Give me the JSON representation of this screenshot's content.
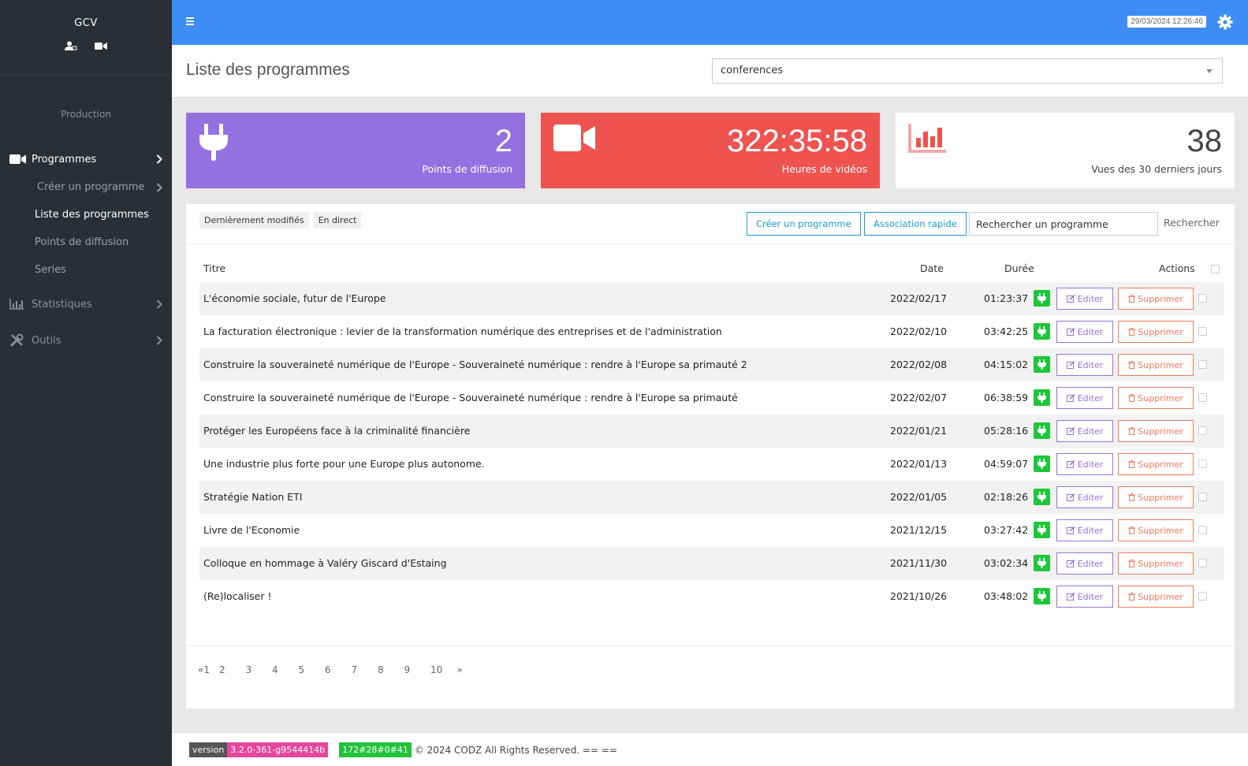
{
  "brand": {
    "name": "GCV"
  },
  "sidebar": {
    "section": "Production",
    "programmes": "Programmes",
    "sub": {
      "create": "Créer un programme",
      "list": "Liste des programmes",
      "points": "Points de diffusion",
      "series": "Series"
    },
    "stats": "Statistiques",
    "tools": "Outils"
  },
  "topbar": {
    "clock": "29/03/2024 12:26:46"
  },
  "header": {
    "title": "Liste des programmes",
    "select_value": "conferences"
  },
  "cards": {
    "points": {
      "value": "2",
      "label": "Points de diffusion"
    },
    "hours": {
      "value": "322:35:58",
      "label": "Heures de vidéos"
    },
    "views": {
      "value": "38",
      "label": "Vues des 30 derniers jours"
    }
  },
  "toolbar": {
    "filter_recent": "Dernièrement modifiés",
    "filter_live": "En direct",
    "create_btn": "Créer un programme",
    "assoc_btn": "Association rapide",
    "search_value": "Rechercher un programme",
    "search_btn": "Rechercher"
  },
  "table": {
    "headers": {
      "title": "Titre",
      "date": "Date",
      "duration": "Durée",
      "actions": "Actions"
    },
    "edit_label": "Editer",
    "delete_label": "Supprimer",
    "rows": [
      {
        "title": "L'économie sociale, futur de l'Europe",
        "date": "2022/02/17",
        "duration": "01:23:37"
      },
      {
        "title": "La facturation électronique : levier de la transformation numérique des entreprises et de l'administration",
        "date": "2022/02/10",
        "duration": "03:42:25"
      },
      {
        "title": "Construire la souveraineté numérique de l'Europe - Souveraineté numérique : rendre à l'Europe sa primauté 2",
        "date": "2022/02/08",
        "duration": "04:15:02"
      },
      {
        "title": "Construire la souveraineté numérique de l'Europe - Souveraineté numérique : rendre à l'Europe sa primauté",
        "date": "2022/02/07",
        "duration": "06:38:59"
      },
      {
        "title": "Protéger les Européens face à la criminalité financière",
        "date": "2022/01/21",
        "duration": "05:28:16"
      },
      {
        "title": "Une industrie plus forte pour une Europe plus autonome.",
        "date": "2022/01/13",
        "duration": "04:59:07"
      },
      {
        "title": "Stratégie Nation ETI",
        "date": "2022/01/05",
        "duration": "02:18:26"
      },
      {
        "title": "Livre de l'Economie",
        "date": "2021/12/15",
        "duration": "03:27:42"
      },
      {
        "title": "Colloque en hommage à Valéry Giscard d'Estaing",
        "date": "2021/11/30",
        "duration": "03:02:34"
      },
      {
        "title": "(Re)localiser !",
        "date": "2021/10/26",
        "duration": "03:48:02"
      }
    ]
  },
  "pagination": {
    "first": "«1",
    "pages": [
      "2",
      "3",
      "4",
      "5",
      "6",
      "7",
      "8",
      "9",
      "10"
    ],
    "next": "»"
  },
  "footer": {
    "version_label": "version",
    "version_value": "3.2.0-361-g9544414b",
    "build": "172#28#0#41",
    "copyright": "© 2024 CODZ All Rights Reserved. == =="
  },
  "colors": {
    "topbar": "#3d8df5",
    "sidebar": "#2a2f36",
    "purple": "#9570e0",
    "red": "#ee5350",
    "green": "#1ec73a"
  }
}
